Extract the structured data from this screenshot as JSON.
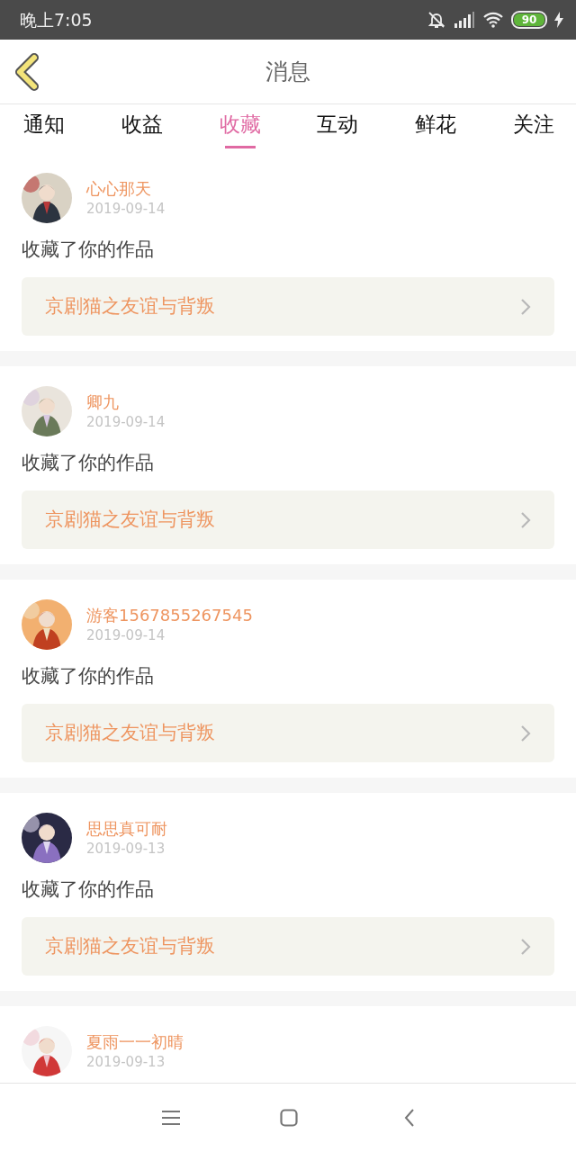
{
  "status_bar": {
    "time": "晚上7:05",
    "battery": "90"
  },
  "header": {
    "title": "消息"
  },
  "tabs": [
    {
      "label": "通知",
      "selected": false
    },
    {
      "label": "收益",
      "selected": false
    },
    {
      "label": "收藏",
      "selected": true
    },
    {
      "label": "互动",
      "selected": false
    },
    {
      "label": "鲜花",
      "selected": false
    },
    {
      "label": "关注",
      "selected": false
    }
  ],
  "messages": [
    {
      "name": "心心那天",
      "date": "2019-09-14",
      "text": "收藏了你的作品",
      "work": "京剧猫之友谊与背叛"
    },
    {
      "name": "卿九",
      "date": "2019-09-14",
      "text": "收藏了你的作品",
      "work": "京剧猫之友谊与背叛"
    },
    {
      "name": "游客1567855267545",
      "date": "2019-09-14",
      "text": "收藏了你的作品",
      "work": "京剧猫之友谊与背叛"
    },
    {
      "name": "思思真可耐",
      "date": "2019-09-13",
      "text": "收藏了你的作品",
      "work": "京剧猫之友谊与背叛"
    },
    {
      "name": "夏雨一一初晴",
      "date": "2019-09-13"
    }
  ]
}
